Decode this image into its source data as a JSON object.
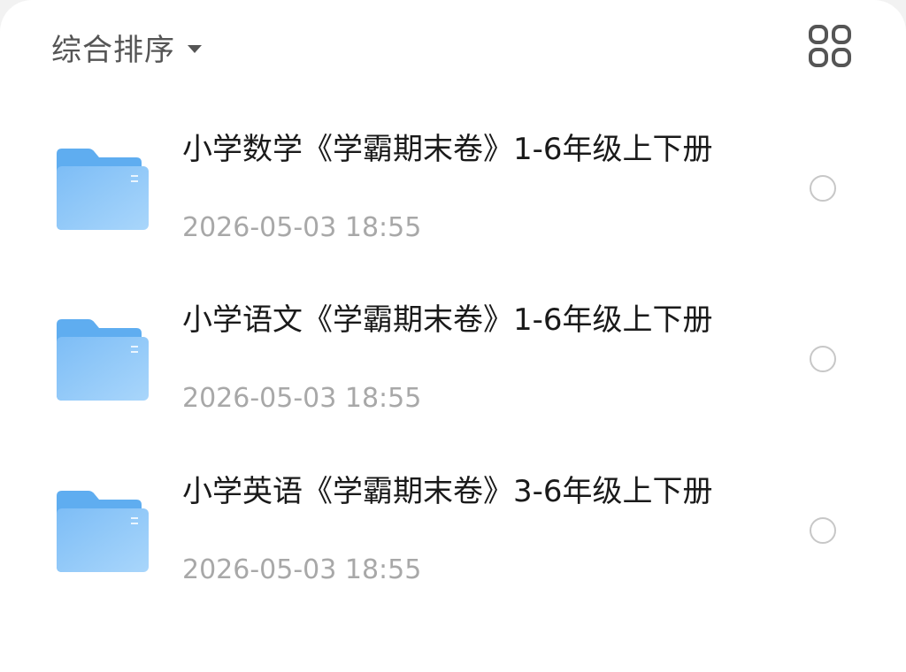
{
  "toolbar": {
    "sort_label": "综合排序"
  },
  "files": [
    {
      "name": "小学数学《学霸期末卷》1-6年级上下册",
      "date": "2026-05-03 18:55"
    },
    {
      "name": "小学语文《学霸期末卷》1-6年级上下册",
      "date": "2026-05-03 18:55"
    },
    {
      "name": "小学英语《学霸期末卷》3-6年级上下册",
      "date": "2026-05-03 18:55"
    }
  ],
  "colors": {
    "folder_back": "#5aaaf0",
    "folder_front": "#8cc8fa",
    "radio_border": "#c7c7c7"
  }
}
